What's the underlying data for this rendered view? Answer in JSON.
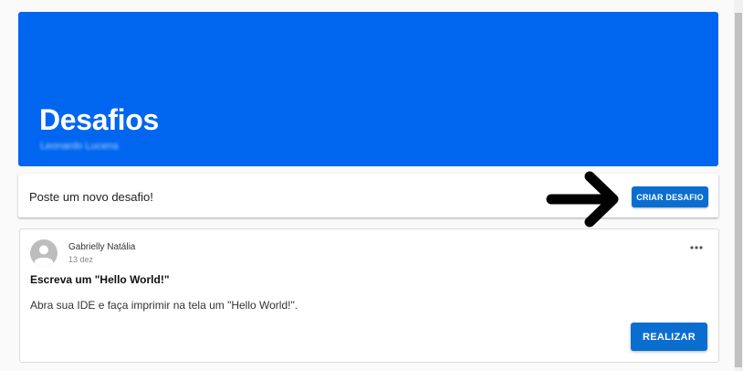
{
  "header": {
    "title": "Desafios",
    "subtitle": "Leonardo Lucena"
  },
  "post_bar": {
    "prompt": "Poste um novo desafio!",
    "button_label": "CRIAR DESAFIO"
  },
  "challenges": [
    {
      "author": "Gabrielly Natália",
      "date": "13 dez",
      "title": "Escreva um \"Hello World!\"",
      "description": "Abra sua IDE e faça imprimir na tela um \"Hello World!\".",
      "button_label": "REALIZAR"
    }
  ],
  "colors": {
    "hero": "#0066f0",
    "button": "#0a6ed1"
  }
}
